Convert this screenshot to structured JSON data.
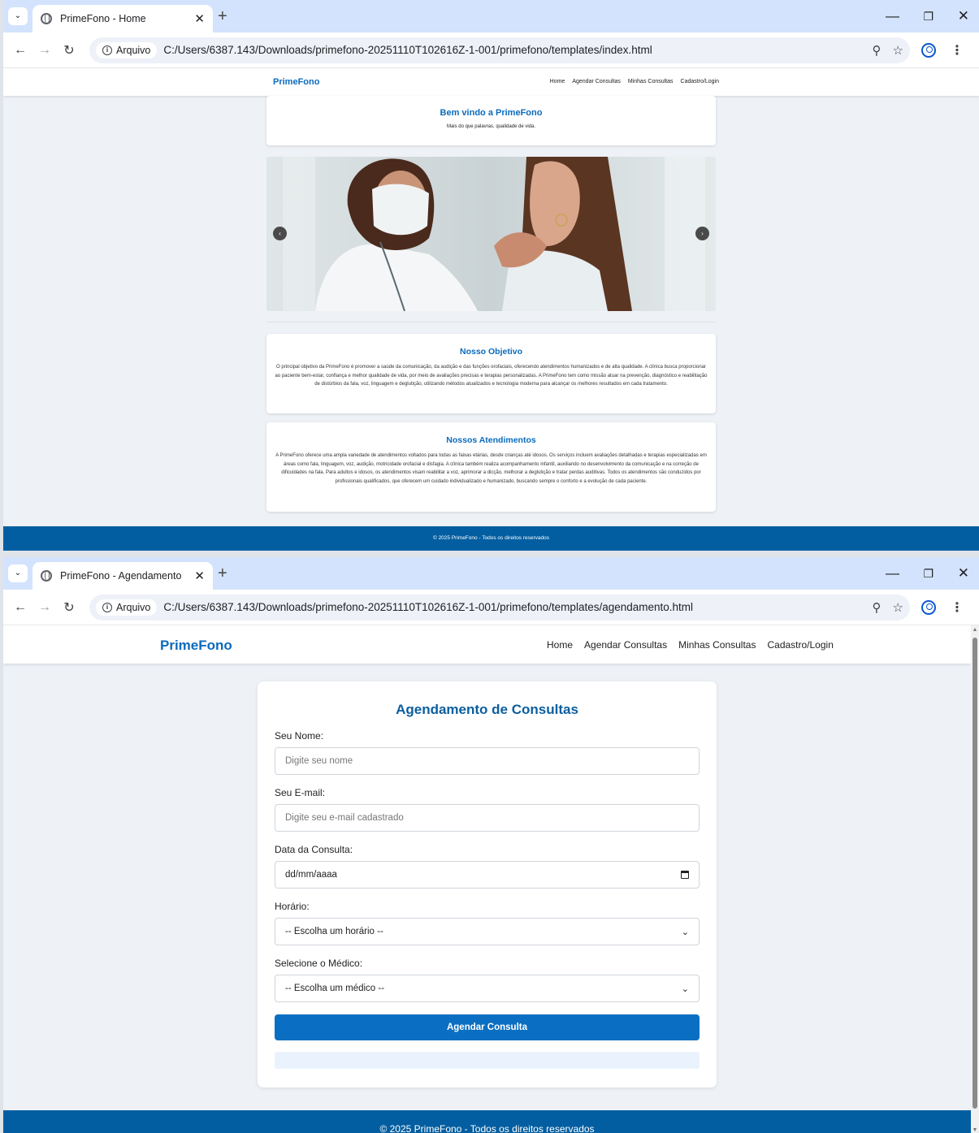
{
  "window1": {
    "tab_title": "PrimeFono - Home",
    "chip_label": "Arquivo",
    "url": "C:/Users/6387.143/Downloads/primefono-20251110T102616Z-1-001/primefono/templates/index.html",
    "page": {
      "brand": "PrimeFono",
      "nav": [
        "Home",
        "Agendar Consultas",
        "Minhas Consultas",
        "Cadastro/Login"
      ],
      "welcome_title": "Bem vindo a PrimeFono",
      "welcome_subtitle": "Mais do que palavras, qualidade de vida.",
      "carousel_prev": "‹",
      "carousel_next": "›",
      "objetivo_title": "Nosso Objetivo",
      "objetivo_text": "O principal objetivo da PrimeFono é promover a saúde da comunicação, da audição e das funções orofaciais, oferecendo atendimentos humanizados e de alta qualidade. A clínica busca proporcionar ao paciente bem-estar, confiança e melhor qualidade de vida, por meio de avaliações precisas e terapias personalizadas. A PrimeFono tem como missão atuar na prevenção, diagnóstico e reabilitação de distúrbios da fala, voz, linguagem e deglutição, utilizando métodos atualizados e tecnologia moderna para alcançar os melhores resultados em cada tratamento.",
      "atendimentos_title": "Nossos Atendimentos",
      "atendimentos_text": "A PrimeFono oferece uma ampla variedade de atendimentos voltados para todas as faixas etárias, desde crianças até idosos. Os serviços incluem avaliações detalhadas e terapias especializadas em áreas como fala, linguagem, voz, audição, motricidade orofacial e disfagia. A clínica também realiza acompanhamento infantil, auxiliando no desenvolvimento da comunicação e na correção de dificuldades na fala. Para adultos e idosos, os atendimentos visam reabilitar a voz, aprimorar a dicção, melhorar a deglutição e tratar perdas auditivas. Todos os atendimentos são conduzidos por profissionais qualificados, que oferecem um cuidado individualizado e humanizado, buscando sempre o conforto e a evolução de cada paciente.",
      "footer": "© 2025 PrimeFono - Todos os direitos reservados"
    }
  },
  "window2": {
    "tab_title": "PrimeFono - Agendamento",
    "chip_label": "Arquivo",
    "url": "C:/Users/6387.143/Downloads/primefono-20251110T102616Z-1-001/primefono/templates/agendamento.html",
    "page": {
      "brand": "PrimeFono",
      "nav": [
        "Home",
        "Agendar Consultas",
        "Minhas Consultas",
        "Cadastro/Login"
      ],
      "form_title": "Agendamento de Consultas",
      "name_label": "Seu Nome:",
      "name_placeholder": "Digite seu nome",
      "email_label": "Seu E-mail:",
      "email_placeholder": "Digite seu e-mail cadastrado",
      "date_label": "Data da Consulta:",
      "date_value": "dd/mm/aaaa",
      "time_label": "Horário:",
      "time_selected": "-- Escolha um horário --",
      "doctor_label": "Selecione o Médico:",
      "doctor_selected": "-- Escolha um médico --",
      "submit_label": "Agendar Consulta",
      "footer": "© 2025 PrimeFono - Todos os direitos reservados"
    }
  },
  "browser": {
    "tab_close": "✕",
    "new_tab": "+",
    "win_min": "—",
    "win_max": "❐",
    "win_close": "✕",
    "tab_search": "⌄",
    "back": "←",
    "forward": "→",
    "reload": "↻",
    "zoom": "⚲",
    "bookmark": "☆",
    "menu": "⋮"
  },
  "colors": {
    "brand_blue": "#0a6bbd",
    "footer_blue": "#025ea1",
    "button_blue": "#0a6fc2"
  }
}
